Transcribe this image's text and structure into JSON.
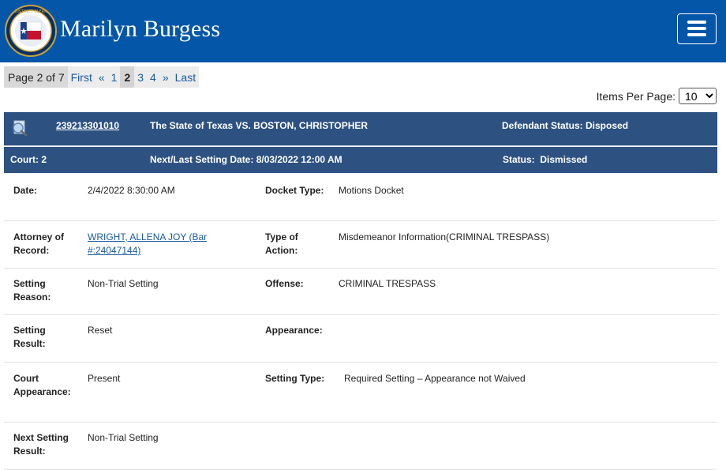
{
  "header": {
    "title": "Marilyn Burgess",
    "seal_icon": "district-clerk-seal-icon",
    "menu_icon": "hamburger-menu-icon",
    "colors": {
      "header_bg": "#0456a8",
      "case_bar_bg": "#2d5282",
      "link": "#1a5aa0"
    }
  },
  "pager": {
    "info": "Page 2 of 7",
    "first": "First",
    "prev": "«",
    "pages": [
      "1",
      "2",
      "3",
      "4"
    ],
    "current": "2",
    "next": "»",
    "last": "Last"
  },
  "items_per_page": {
    "label": "Items Per Page:",
    "value": "10"
  },
  "case": {
    "icon": "magnifier-document-icon",
    "number": "239213301010",
    "style": "The State of Texas VS. BOSTON, CHRISTOPHER",
    "defendant_status": "Defendant Status: Disposed",
    "court": "Court: 2",
    "next_setting": "Next/Last Setting Date: 8/03/2022 12:00 AM",
    "status": "Status:  Dismissed"
  },
  "details": {
    "date_label": "Date:",
    "date_value": "2/4/2022 8:30:00 AM",
    "docket_type_label": "Docket Type:",
    "docket_type_value": "Motions Docket",
    "attorney_label": "Attorney of Record:",
    "attorney_value": "WRIGHT, ALLENA JOY (Bar #:24047144)",
    "type_of_action_label": "Type of Action:",
    "type_of_action_value": "Misdemeanor Information(CRIMINAL TRESPASS)",
    "setting_reason_label": "Setting Reason:",
    "setting_reason_value": "Non-Trial Setting",
    "offense_label": "Offense:",
    "offense_value": "CRIMINAL TRESPASS",
    "setting_result_label": "Setting Result:",
    "setting_result_value": "Reset",
    "appearance_label": "Appearance:",
    "appearance_value": "",
    "court_appearance_label": "Court Appearance:",
    "court_appearance_value": "Present",
    "setting_type_label": "Setting Type:",
    "setting_type_value": "Required Setting – Appearance not Waived",
    "next_setting_result_label": "Next Setting Result:",
    "next_setting_result_value": "Non-Trial Setting"
  }
}
